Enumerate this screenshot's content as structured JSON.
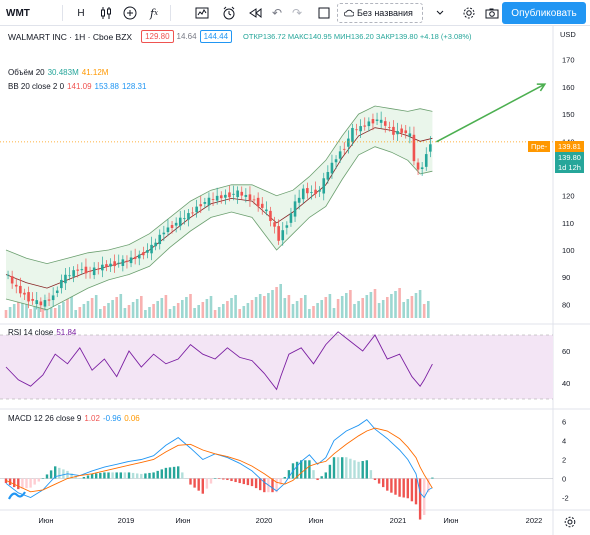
{
  "toolbar": {
    "symbol": "WMT",
    "interval": "H",
    "compare_icon": "plus-circle-icon",
    "indicators_icon": "fx-icon",
    "layout_name": "Без названия",
    "publish_label": "Опубликовать"
  },
  "legend": {
    "title": "WALMART INC · 1H · Cboe BZX",
    "bid": "129.80",
    "spread": "14.64",
    "ask": "144.44",
    "ohlc": "ОТКР136.72 МАКС140.95 МИН136.20 ЗАКР139.80 +4.18 (+3.08%)",
    "volume_label": "Объём 20",
    "volume_values": [
      "30.483M",
      "41.12M"
    ],
    "bb_label": "BB 20 close 2 0",
    "bb_values": [
      "141.09",
      "153.88",
      "128.31"
    ],
    "rsi_label": "RSI 14 close",
    "rsi_value": "51.84",
    "macd_label": "MACD 12 26 close 9",
    "macd_values": [
      "1.02",
      "-0.96",
      "0.06"
    ]
  },
  "price_scale": {
    "currency": "USD",
    "ticks": [
      170,
      160,
      150,
      140,
      130,
      120,
      110,
      100,
      90,
      80
    ],
    "pre_label": "Пре-",
    "pre_price": "139.81",
    "last_price": "139.80",
    "countdown": "1d 12h"
  },
  "rsi_scale": {
    "ticks": [
      60,
      40
    ]
  },
  "macd_scale": {
    "ticks": [
      6,
      4,
      2,
      0,
      -2
    ]
  },
  "time_axis": [
    "Июн",
    "2019",
    "Июн",
    "2020",
    "Июн",
    "2021",
    "Июн",
    "2022"
  ],
  "colors": {
    "up": "#26a69a",
    "down": "#ef5350",
    "bb_basis": "#872323",
    "bb_fill": "#e8f5e9",
    "bb_band": "#6b9f6f",
    "rsi": "#7b1fa2",
    "rsi_fill": "#f3e5f5",
    "macd": "#2196f3",
    "signal": "#ff6d00",
    "arrow": "#4caf50",
    "accent": "#2196f3"
  },
  "chart_data": {
    "type": "candlestick",
    "price_range": [
      75,
      178
    ],
    "price_points": [
      [
        0,
        92
      ],
      [
        3,
        86
      ],
      [
        6,
        82
      ],
      [
        9,
        80
      ],
      [
        12,
        83
      ],
      [
        14,
        89
      ],
      [
        16,
        91
      ],
      [
        18,
        93
      ],
      [
        21,
        92
      ],
      [
        24,
        94
      ],
      [
        27,
        95
      ],
      [
        30,
        96
      ],
      [
        33,
        98
      ],
      [
        36,
        101
      ],
      [
        39,
        107
      ],
      [
        42,
        110
      ],
      [
        45,
        113
      ],
      [
        48,
        117
      ],
      [
        51,
        119
      ],
      [
        54,
        120
      ],
      [
        57,
        121
      ],
      [
        60,
        119
      ],
      [
        62,
        117
      ],
      [
        64,
        114
      ],
      [
        66,
        108
      ],
      [
        67,
        104
      ],
      [
        69,
        110
      ],
      [
        71,
        117
      ],
      [
        73,
        122
      ],
      [
        75,
        121
      ],
      [
        77,
        122
      ],
      [
        79,
        129
      ],
      [
        81,
        134
      ],
      [
        83,
        138
      ],
      [
        85,
        144
      ],
      [
        87,
        145
      ],
      [
        89,
        147
      ],
      [
        91,
        148
      ],
      [
        93,
        146
      ],
      [
        95,
        143
      ],
      [
        97,
        144
      ],
      [
        99,
        142
      ],
      [
        100,
        133
      ],
      [
        101,
        129
      ],
      [
        102,
        131
      ],
      [
        103,
        135
      ],
      [
        104,
        139.8
      ]
    ],
    "bb_upper": [
      [
        0,
        100
      ],
      [
        5,
        97
      ],
      [
        10,
        95
      ],
      [
        15,
        97
      ],
      [
        20,
        99
      ],
      [
        25,
        100
      ],
      [
        30,
        102
      ],
      [
        35,
        106
      ],
      [
        40,
        112
      ],
      [
        45,
        118
      ],
      [
        50,
        122
      ],
      [
        55,
        124
      ],
      [
        60,
        124
      ],
      [
        63,
        122
      ],
      [
        66,
        120
      ],
      [
        70,
        122
      ],
      [
        74,
        127
      ],
      [
        78,
        133
      ],
      [
        82,
        142
      ],
      [
        86,
        150
      ],
      [
        90,
        153
      ],
      [
        94,
        152
      ],
      [
        98,
        151
      ],
      [
        101,
        152
      ],
      [
        104,
        151
      ]
    ],
    "bb_lower": [
      [
        0,
        82
      ],
      [
        5,
        80
      ],
      [
        10,
        78
      ],
      [
        15,
        82
      ],
      [
        20,
        86
      ],
      [
        25,
        89
      ],
      [
        30,
        91
      ],
      [
        35,
        94
      ],
      [
        40,
        101
      ],
      [
        45,
        107
      ],
      [
        50,
        112
      ],
      [
        55,
        114
      ],
      [
        60,
        112
      ],
      [
        63,
        106
      ],
      [
        66,
        100
      ],
      [
        70,
        106
      ],
      [
        74,
        112
      ],
      [
        78,
        116
      ],
      [
        82,
        126
      ],
      [
        86,
        135
      ],
      [
        90,
        138
      ],
      [
        94,
        136
      ],
      [
        98,
        133
      ],
      [
        101,
        128
      ],
      [
        104,
        129
      ]
    ],
    "bb_basis": [
      [
        0,
        91
      ],
      [
        5,
        88
      ],
      [
        10,
        86
      ],
      [
        15,
        89
      ],
      [
        20,
        92
      ],
      [
        25,
        94
      ],
      [
        30,
        96
      ],
      [
        35,
        100
      ],
      [
        40,
        106
      ],
      [
        45,
        112
      ],
      [
        50,
        117
      ],
      [
        55,
        119
      ],
      [
        60,
        118
      ],
      [
        63,
        114
      ],
      [
        66,
        110
      ],
      [
        70,
        114
      ],
      [
        74,
        119
      ],
      [
        78,
        124
      ],
      [
        82,
        134
      ],
      [
        86,
        142
      ],
      [
        90,
        145
      ],
      [
        94,
        144
      ],
      [
        98,
        142
      ],
      [
        101,
        140
      ],
      [
        104,
        141.09
      ]
    ],
    "forecast_arrow": {
      "from": [
        104,
        139.8
      ],
      "to": [
        128,
        161
      ]
    },
    "rsi": {
      "range": [
        25,
        75
      ],
      "bands": [
        70,
        30
      ],
      "points": [
        [
          0,
          50
        ],
        [
          3,
          42
        ],
        [
          6,
          38
        ],
        [
          9,
          45
        ],
        [
          12,
          58
        ],
        [
          15,
          52
        ],
        [
          18,
          62
        ],
        [
          21,
          48
        ],
        [
          24,
          55
        ],
        [
          27,
          44
        ],
        [
          30,
          60
        ],
        [
          33,
          50
        ],
        [
          36,
          58
        ],
        [
          39,
          52
        ],
        [
          42,
          55
        ],
        [
          45,
          64
        ],
        [
          48,
          58
        ],
        [
          51,
          55
        ],
        [
          54,
          62
        ],
        [
          57,
          56
        ],
        [
          60,
          54
        ],
        [
          63,
          46
        ],
        [
          66,
          36
        ],
        [
          67,
          44
        ],
        [
          69,
          58
        ],
        [
          72,
          62
        ],
        [
          75,
          52
        ],
        [
          78,
          64
        ],
        [
          81,
          72
        ],
        [
          84,
          66
        ],
        [
          87,
          60
        ],
        [
          90,
          70
        ],
        [
          93,
          55
        ],
        [
          96,
          58
        ],
        [
          99,
          44
        ],
        [
          101,
          38
        ],
        [
          102,
          42
        ],
        [
          104,
          51.84
        ]
      ]
    },
    "macd": {
      "range": [
        -3,
        7
      ],
      "macd_line": [
        [
          0,
          -0.5
        ],
        [
          3,
          -1.5
        ],
        [
          6,
          -2.0
        ],
        [
          9,
          -1.2
        ],
        [
          12,
          0.2
        ],
        [
          15,
          0.5
        ],
        [
          18,
          0.3
        ],
        [
          21,
          0.8
        ],
        [
          24,
          1.2
        ],
        [
          27,
          1.5
        ],
        [
          30,
          1.8
        ],
        [
          33,
          2.0
        ],
        [
          36,
          2.4
        ],
        [
          39,
          3.5
        ],
        [
          42,
          4.3
        ],
        [
          45,
          3.2
        ],
        [
          48,
          2.0
        ],
        [
          51,
          2.6
        ],
        [
          54,
          2.2
        ],
        [
          57,
          1.6
        ],
        [
          60,
          0.8
        ],
        [
          63,
          -0.4
        ],
        [
          66,
          -1.3
        ],
        [
          68,
          -0.5
        ],
        [
          70,
          0.8
        ],
        [
          72,
          1.8
        ],
        [
          74,
          2.5
        ],
        [
          76,
          1.5
        ],
        [
          78,
          2.2
        ],
        [
          80,
          4.0
        ],
        [
          83,
          5.0
        ],
        [
          86,
          5.6
        ],
        [
          88,
          6.2
        ],
        [
          90,
          5.2
        ],
        [
          93,
          4.2
        ],
        [
          96,
          3.0
        ],
        [
          98,
          2.0
        ],
        [
          100,
          0.5
        ],
        [
          101,
          -1.5
        ],
        [
          102,
          -2.0
        ],
        [
          103,
          -1.2
        ],
        [
          104,
          -0.96
        ]
      ],
      "signal_line": [
        [
          0,
          -0.2
        ],
        [
          3,
          -0.8
        ],
        [
          6,
          -1.4
        ],
        [
          9,
          -1.2
        ],
        [
          12,
          -0.6
        ],
        [
          15,
          0.0
        ],
        [
          18,
          0.3
        ],
        [
          21,
          0.5
        ],
        [
          24,
          0.8
        ],
        [
          27,
          1.1
        ],
        [
          30,
          1.4
        ],
        [
          33,
          1.7
        ],
        [
          36,
          2.0
        ],
        [
          39,
          2.8
        ],
        [
          42,
          3.5
        ],
        [
          45,
          3.6
        ],
        [
          48,
          3.0
        ],
        [
          51,
          2.6
        ],
        [
          54,
          2.3
        ],
        [
          57,
          1.9
        ],
        [
          60,
          1.3
        ],
        [
          63,
          0.5
        ],
        [
          66,
          -0.4
        ],
        [
          68,
          -0.6
        ],
        [
          70,
          -0.2
        ],
        [
          72,
          0.6
        ],
        [
          74,
          1.3
        ],
        [
          76,
          1.6
        ],
        [
          78,
          1.8
        ],
        [
          80,
          2.6
        ],
        [
          83,
          3.6
        ],
        [
          86,
          4.5
        ],
        [
          88,
          5.0
        ],
        [
          90,
          5.3
        ],
        [
          93,
          5.0
        ],
        [
          96,
          4.2
        ],
        [
          98,
          3.3
        ],
        [
          100,
          2.2
        ],
        [
          101,
          1.2
        ],
        [
          102,
          0.4
        ],
        [
          103,
          -0.3
        ],
        [
          104,
          -1.02
        ]
      ]
    }
  }
}
